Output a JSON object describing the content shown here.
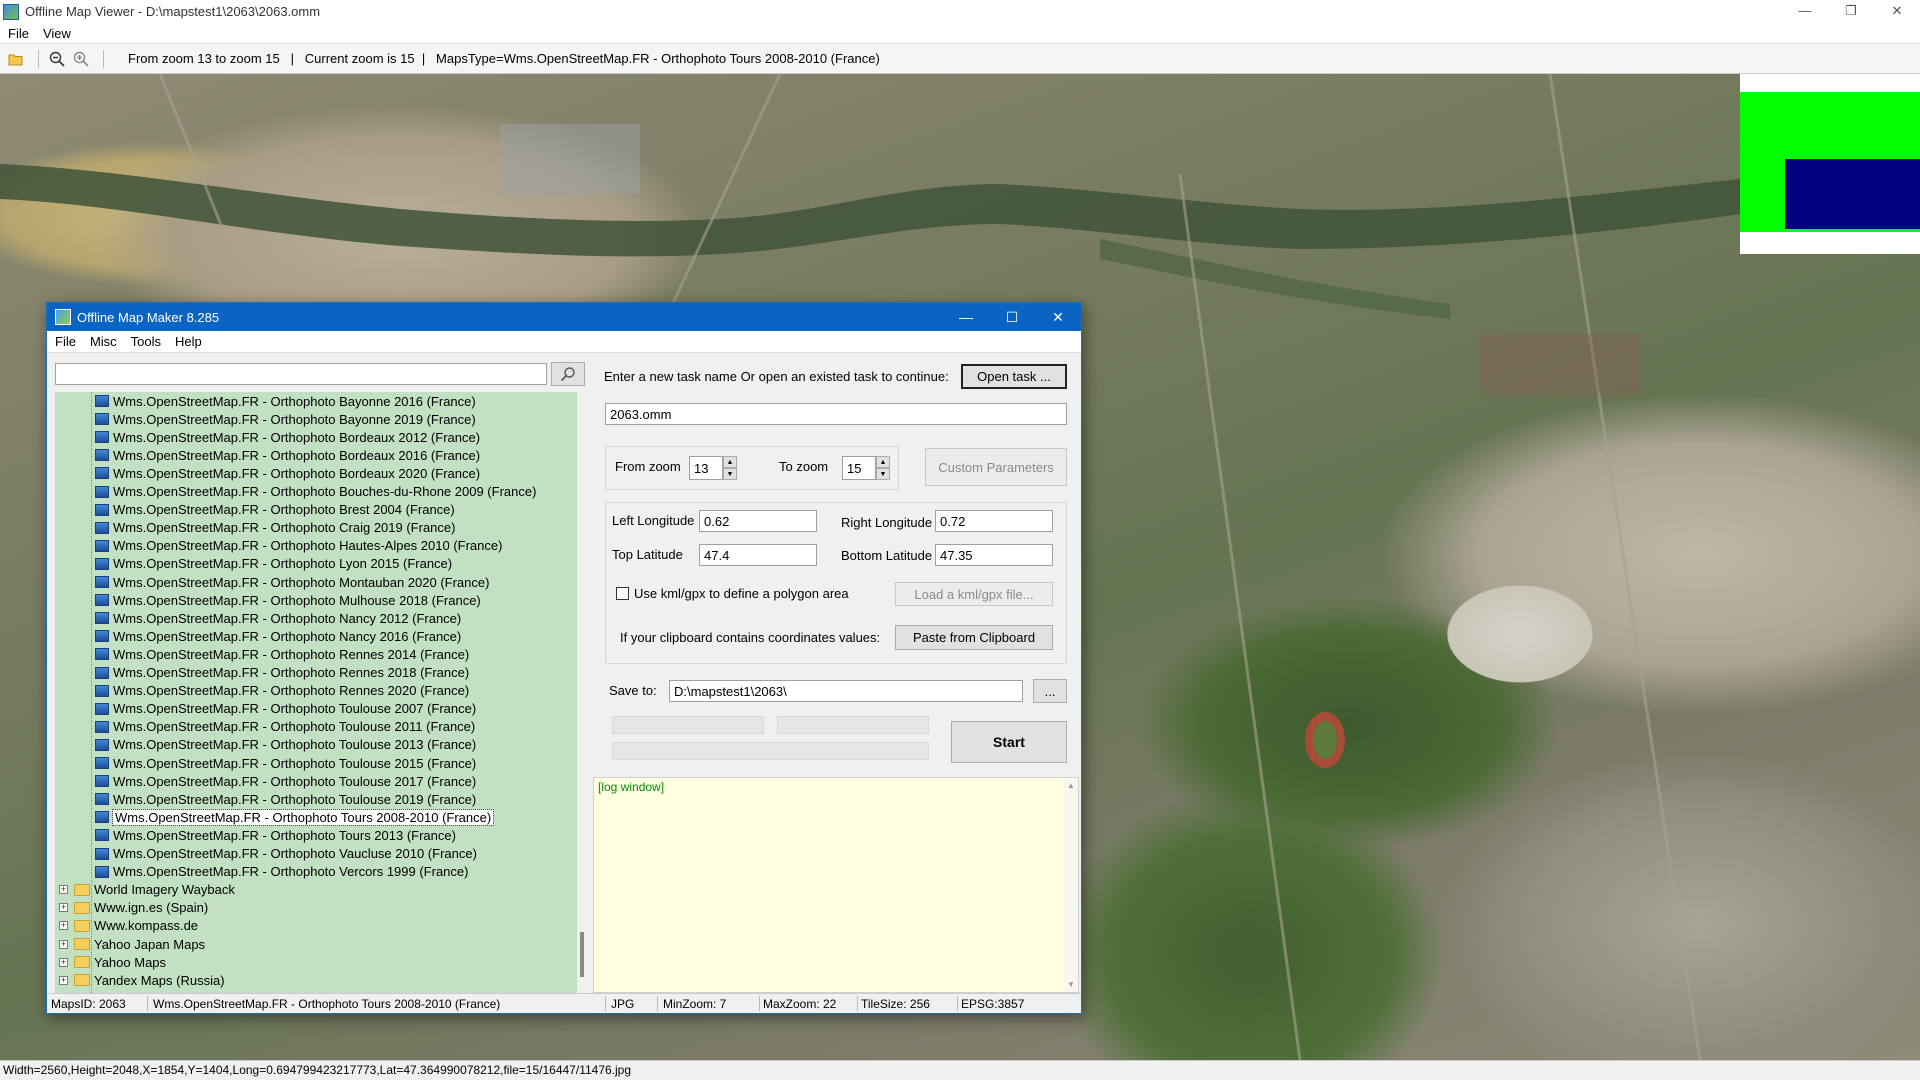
{
  "viewer": {
    "title": "Offline Map Viewer - D:\\mapstest1\\2063\\2063.omm",
    "menu": [
      "File",
      "View"
    ],
    "toolbar_info": "From zoom 13 to zoom 15   |   Current zoom is 15  |   MapsType=Wms.OpenStreetMap.FR - Orthophoto Tours 2008-2010 (France)",
    "status": "Width=2560,Height=2048,X=1854,Y=1404,Long=0.694799423217773,Lat=47.364990078212,file=15/16447/11476.jpg",
    "icons": [
      "folder-open-icon",
      "zoom-out-icon",
      "zoom-in-icon"
    ],
    "minimap_colors": {
      "frame": "#00ff00",
      "view": "#000080"
    }
  },
  "dialog": {
    "title": "Offline Map Maker 8.285",
    "menu": [
      "File",
      "Misc",
      "Tools",
      "Help"
    ],
    "search": {
      "value": "",
      "placeholder": ""
    },
    "task_prompt": "Enter a new task name Or open an existed task to continue:",
    "open_task_label": "Open task ...",
    "task_name": "2063.omm",
    "from_zoom_label": "From zoom",
    "from_zoom": "13",
    "to_zoom_label": "To zoom",
    "to_zoom": "15",
    "custom_params_label": "Custom Parameters",
    "left_lon_label": "Left Longitude",
    "left_lon": "0.62",
    "right_lon_label": "Right Longitude",
    "right_lon": "0.72",
    "top_lat_label": "Top Latitude",
    "top_lat": "47.4",
    "bottom_lat_label": "Bottom Latitude",
    "bottom_lat": "47.35",
    "kml_label": "Use kml/gpx to define a polygon area",
    "kml_checked": false,
    "load_kml_label": "Load a kml/gpx file...",
    "clipboard_label": "If your clipboard contains coordinates values:",
    "paste_label": "Paste from Clipboard",
    "save_to_label": "Save to:",
    "save_to": "D:\\mapstest1\\2063\\",
    "browse_label": "...",
    "start_label": "Start",
    "log_text": "[log window]",
    "tree_items": [
      "Wms.OpenStreetMap.FR - Orthophoto Bayonne 2016 (France)",
      "Wms.OpenStreetMap.FR - Orthophoto Bayonne 2019 (France)",
      "Wms.OpenStreetMap.FR - Orthophoto Bordeaux 2012 (France)",
      "Wms.OpenStreetMap.FR - Orthophoto Bordeaux 2016 (France)",
      "Wms.OpenStreetMap.FR - Orthophoto Bordeaux 2020 (France)",
      "Wms.OpenStreetMap.FR - Orthophoto Bouches-du-Rhone 2009 (France)",
      "Wms.OpenStreetMap.FR - Orthophoto Brest 2004 (France)",
      "Wms.OpenStreetMap.FR - Orthophoto Craig 2019 (France)",
      "Wms.OpenStreetMap.FR - Orthophoto Hautes-Alpes 2010 (France)",
      "Wms.OpenStreetMap.FR - Orthophoto Lyon 2015 (France)",
      "Wms.OpenStreetMap.FR - Orthophoto Montauban 2020 (France)",
      "Wms.OpenStreetMap.FR - Orthophoto Mulhouse 2018 (France)",
      "Wms.OpenStreetMap.FR - Orthophoto Nancy 2012 (France)",
      "Wms.OpenStreetMap.FR - Orthophoto Nancy 2016 (France)",
      "Wms.OpenStreetMap.FR - Orthophoto Rennes 2014 (France)",
      "Wms.OpenStreetMap.FR - Orthophoto Rennes 2018 (France)",
      "Wms.OpenStreetMap.FR - Orthophoto Rennes 2020 (France)",
      "Wms.OpenStreetMap.FR - Orthophoto Toulouse 2007 (France)",
      "Wms.OpenStreetMap.FR - Orthophoto Toulouse 2011 (France)",
      "Wms.OpenStreetMap.FR - Orthophoto Toulouse 2013 (France)",
      "Wms.OpenStreetMap.FR - Orthophoto Toulouse 2015 (France)",
      "Wms.OpenStreetMap.FR - Orthophoto Toulouse 2017 (France)",
      "Wms.OpenStreetMap.FR - Orthophoto Toulouse 2019 (France)",
      "Wms.OpenStreetMap.FR - Orthophoto Tours 2008-2010 (France)",
      "Wms.OpenStreetMap.FR - Orthophoto Tours 2013 (France)",
      "Wms.OpenStreetMap.FR - Orthophoto Vaucluse 2010 (France)",
      "Wms.OpenStreetMap.FR - Orthophoto Vercors 1999 (France)"
    ],
    "selected_item": "Wms.OpenStreetMap.FR - Orthophoto Tours 2008-2010 (France)",
    "tree_folders": [
      "World Imagery Wayback",
      "Www.ign.es (Spain)",
      "Www.kompass.de",
      "Yahoo Japan Maps",
      "Yahoo Maps",
      "Yandex Maps (Russia)"
    ],
    "status": {
      "maps_id": "MapsID: 2063",
      "map_name": "Wms.OpenStreetMap.FR - Orthophoto Tours 2008-2010 (France)",
      "format": "JPG",
      "min_zoom": "MinZoom: 7",
      "max_zoom": "MaxZoom: 22",
      "tile_size": "TileSize: 256",
      "epsg": "EPSG:3857"
    }
  }
}
